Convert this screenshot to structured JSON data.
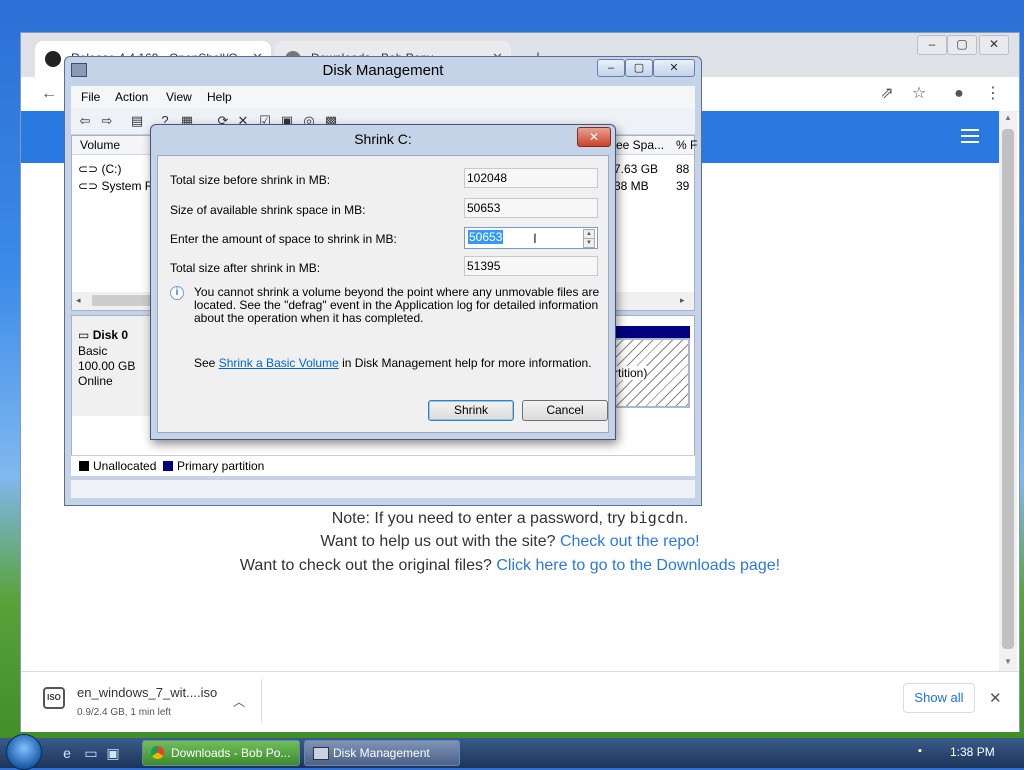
{
  "chrome": {
    "tabs": [
      {
        "label": "Release 4.4.169 · OpenShell/O..."
      },
      {
        "label": "Downloads - Bob Pony"
      }
    ],
    "page": {
      "note_prefix": "Note: If you need to enter a password, try",
      "note_code": "bigcdn",
      "note_suffix": ".",
      "help_prefix": "Want to help us out with the site?",
      "help_link": "Check out the repo!",
      "files_prefix": "Want to check out the original files?",
      "files_link": "Click here to go to the Downloads page!"
    },
    "download": {
      "filename": "en_windows_7_wit....iso",
      "status": "0.9/2.4 GB, 1 min left",
      "icon_text": "ISO",
      "show_all": "Show all"
    }
  },
  "disk_mgmt": {
    "title": "Disk Management",
    "menu": [
      "File",
      "Action",
      "View",
      "Help"
    ],
    "columns": {
      "volume": "Volume",
      "free_space": "ree Spa...",
      "pct_free": "% F"
    },
    "volumes": [
      {
        "name": "(C:)",
        "free": "7.63 GB",
        "pct": "88"
      },
      {
        "name": "System Res",
        "free": "38 MB",
        "pct": "39"
      }
    ],
    "disk": {
      "name": "Disk 0",
      "type": "Basic",
      "size": "100.00 GB",
      "status": "Online",
      "partition_fragment": "rtition)"
    },
    "legend": [
      {
        "label": "Unallocated",
        "color": "#000000"
      },
      {
        "label": "Primary partition",
        "color": "#000080"
      }
    ]
  },
  "shrink": {
    "title": "Shrink C:",
    "fields": {
      "total_before_label": "Total size before shrink in MB:",
      "total_before_value": "102048",
      "available_label": "Size of available shrink space in MB:",
      "available_value": "50653",
      "amount_label": "Enter the amount of space to shrink in MB:",
      "amount_value": "50653",
      "total_after_label": "Total size after shrink in MB:",
      "total_after_value": "51395"
    },
    "info": "You cannot shrink a volume beyond the point where any unmovable files are located. See the \"defrag\" event in the Application log for detailed information about the operation when it has completed.",
    "see_prefix": "See",
    "see_link": "Shrink a Basic Volume",
    "see_suffix": "in Disk Management help for more information.",
    "shrink_button": "Shrink",
    "cancel_button": "Cancel"
  },
  "taskbar": {
    "tasks": [
      {
        "label": "Downloads - Bob Po..."
      },
      {
        "label": "Disk Management"
      }
    ],
    "clock": "1:38 PM"
  }
}
